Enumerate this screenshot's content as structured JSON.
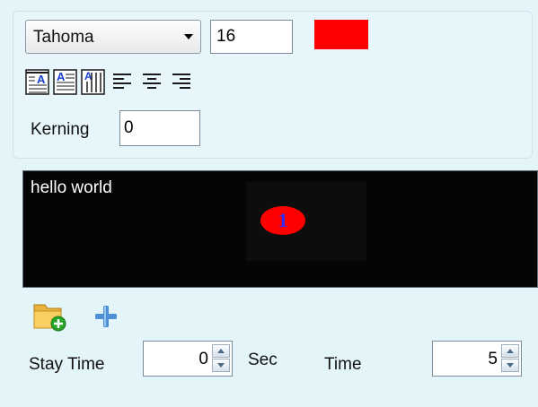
{
  "text_format": {
    "font_family": "Tahoma",
    "font_size": "16",
    "text_color": "#ff0000",
    "kerning_label": "Kerning",
    "kerning_value": "0"
  },
  "toolbar": {
    "icons": [
      "align-top-icon",
      "align-middle-icon",
      "align-bottom-icon",
      "align-left-icon",
      "align-center-icon",
      "align-right-icon"
    ]
  },
  "preview": {
    "text": "hello world",
    "page_number": "1",
    "badge_color": "#ff0000",
    "badge_text_color": "#2b2bff"
  },
  "timing": {
    "stay_time_label": "Stay Time",
    "stay_time_value": "0",
    "sec_label": "Sec",
    "time_label": "Time",
    "time_value": "5"
  },
  "actions": {
    "icons": [
      "add-folder-icon",
      "add-icon"
    ]
  }
}
